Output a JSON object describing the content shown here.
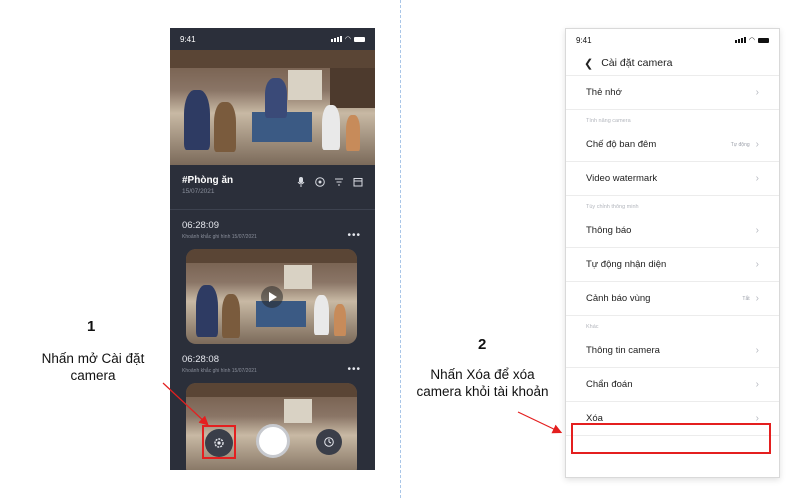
{
  "left_phone": {
    "status_time": "9:41",
    "camera_name": "#Phòng ăn",
    "camera_date": "15/07/2021",
    "clips": [
      {
        "time": "06:28:09",
        "caption": "Khoảnh khắc ghi hình 15/07/2021",
        "more": "•••"
      },
      {
        "time": "06:28:08",
        "caption": "Khoảnh khắc ghi hình 15/07/2021",
        "more": "•••"
      }
    ],
    "icons": [
      "mic-icon",
      "ptz-icon",
      "filter-icon",
      "calendar-icon"
    ],
    "bottom_icons": [
      "settings-icon",
      "capture-button",
      "history-icon"
    ],
    "highlight_color": "#e41f1f"
  },
  "step1": {
    "number": "1",
    "line1": "Nhấn mở Cài đặt",
    "line2": "camera"
  },
  "step2": {
    "number": "2",
    "line1": "Nhấn Xóa để xóa",
    "line2": "camera khỏi tài khoản"
  },
  "right_phone": {
    "status_time": "9:41",
    "title": "Cài đặt camera",
    "items": [
      {
        "label": "Thẻ nhớ",
        "value": ""
      },
      {
        "section": "Tính năng camera"
      },
      {
        "label": "Chế độ ban đêm",
        "value": "Tự động"
      },
      {
        "label": "Video watermark",
        "value": ""
      },
      {
        "section": "Tùy chỉnh thông minh"
      },
      {
        "label": "Thông báo",
        "value": ""
      },
      {
        "label": "Tự động nhận diện",
        "value": ""
      },
      {
        "label": "Cảnh báo vùng",
        "value": "Tắt"
      },
      {
        "section": "Khác"
      },
      {
        "label": "Thông tin camera",
        "value": ""
      },
      {
        "label": "Chẩn đoán",
        "value": ""
      },
      {
        "label": "Xóa",
        "value": ""
      }
    ],
    "chevron": "›"
  }
}
